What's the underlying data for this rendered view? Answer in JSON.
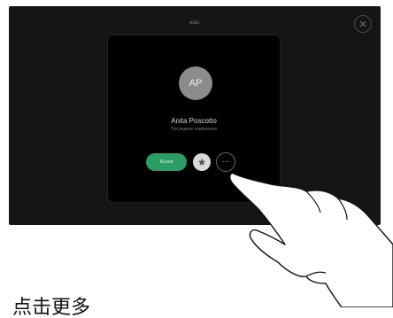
{
  "screen": {
    "title": "нас",
    "contact": {
      "initials": "AP",
      "name": "Anita Poscotto",
      "detail": "Последнее изменение"
    },
    "buttons": {
      "call_label": "Вызов",
      "more_label": "…"
    }
  },
  "caption": "点击更多",
  "colors": {
    "screen_bg": "#151515",
    "call_green": "#2b9e63",
    "avatar_gray": "#8c8c8c"
  }
}
